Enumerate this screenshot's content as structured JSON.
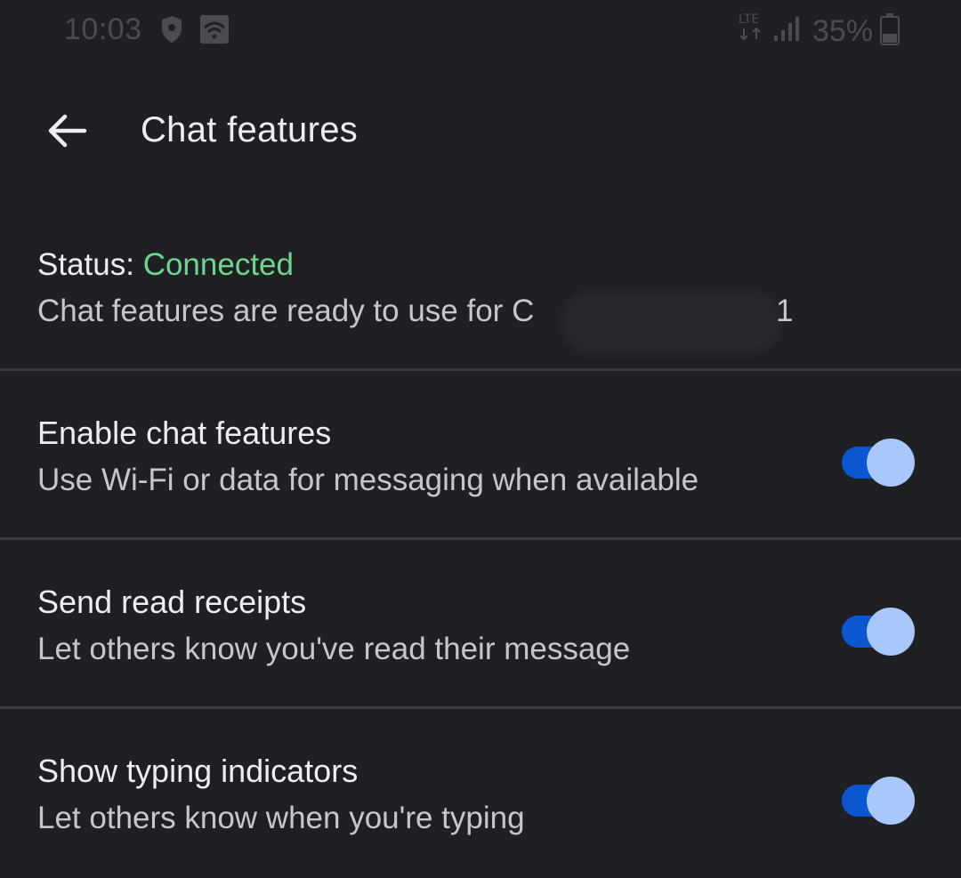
{
  "status_bar": {
    "time": "10:03",
    "battery_percent": "35%",
    "network_type": "LTE",
    "icons": [
      "shield-icon",
      "wifi-icon",
      "lte-icon",
      "signal-icon",
      "battery-icon"
    ]
  },
  "app_bar": {
    "title": "Chat features",
    "back_icon": "arrow-back-icon"
  },
  "status": {
    "label": "Status:",
    "value": "Connected",
    "description": "Chat features are ready to use for C",
    "description_tail": "1"
  },
  "settings": [
    {
      "title": "Enable chat features",
      "subtitle": "Use Wi-Fi or data for messaging when available",
      "enabled": true
    },
    {
      "title": "Send read receipts",
      "subtitle": "Let others know you've read their message",
      "enabled": true
    },
    {
      "title": "Show typing indicators",
      "subtitle": "Let others know when you're typing",
      "enabled": true
    }
  ],
  "colors": {
    "background": "#1f2023",
    "accent_connected": "#6dd58c",
    "toggle_track": "#0b57d0",
    "toggle_thumb": "#a8c7fa",
    "divider": "#3b3d41"
  }
}
